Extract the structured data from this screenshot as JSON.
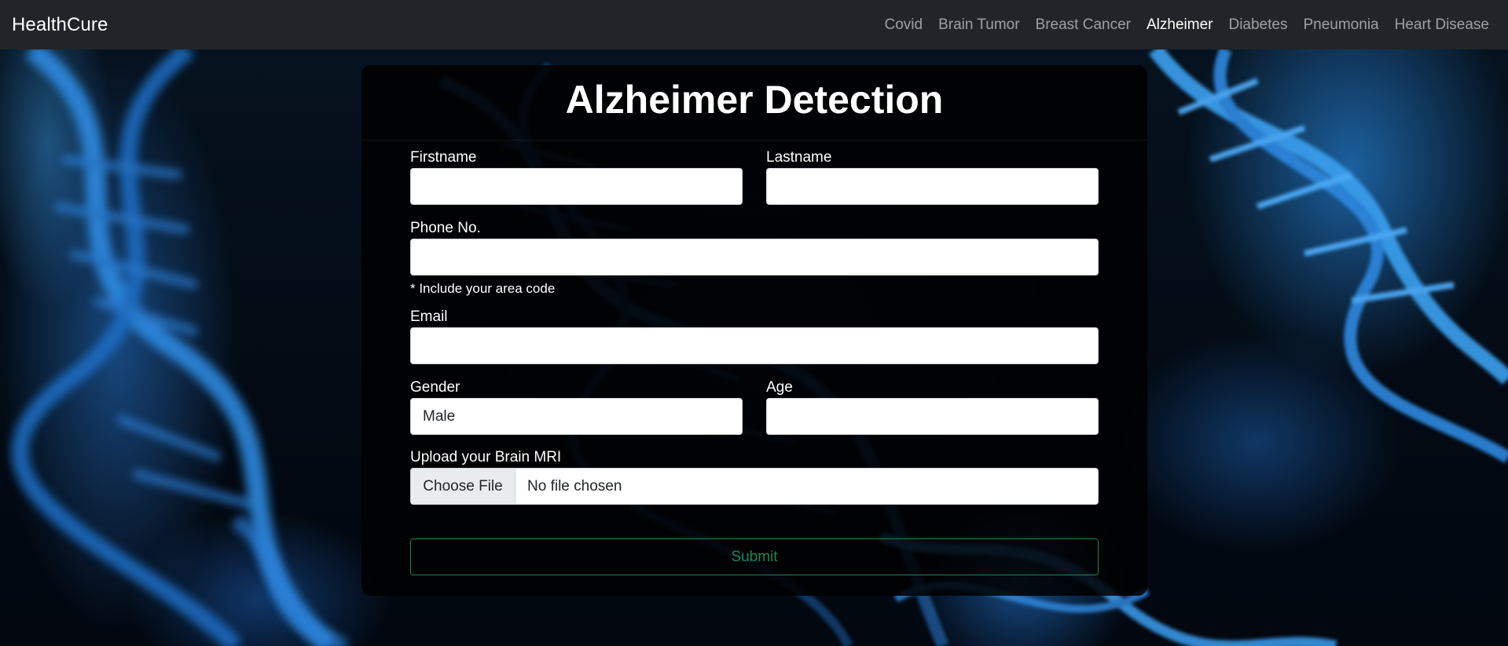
{
  "navbar": {
    "brand": "HealthCure",
    "links": [
      {
        "label": "Covid",
        "active": false
      },
      {
        "label": "Brain Tumor",
        "active": false
      },
      {
        "label": "Breast Cancer",
        "active": false
      },
      {
        "label": "Alzheimer",
        "active": true
      },
      {
        "label": "Diabetes",
        "active": false
      },
      {
        "label": "Pneumonia",
        "active": false
      },
      {
        "label": "Heart Disease",
        "active": false
      }
    ]
  },
  "form": {
    "title": "Alzheimer Detection",
    "firstname": {
      "label": "Firstname",
      "value": ""
    },
    "lastname": {
      "label": "Lastname",
      "value": ""
    },
    "phone": {
      "label": "Phone No.",
      "value": "",
      "hint": "* Include your area code"
    },
    "email": {
      "label": "Email",
      "value": ""
    },
    "gender": {
      "label": "Gender",
      "selected": "Male"
    },
    "age": {
      "label": "Age",
      "value": ""
    },
    "upload": {
      "label": "Upload your Brain MRI",
      "button": "Choose File",
      "status": "No file chosen"
    },
    "submit": "Submit"
  },
  "colors": {
    "navbar_bg": "#212529",
    "submit_accent": "#198754"
  },
  "background": {
    "description_icon": "dna-helix-image"
  }
}
